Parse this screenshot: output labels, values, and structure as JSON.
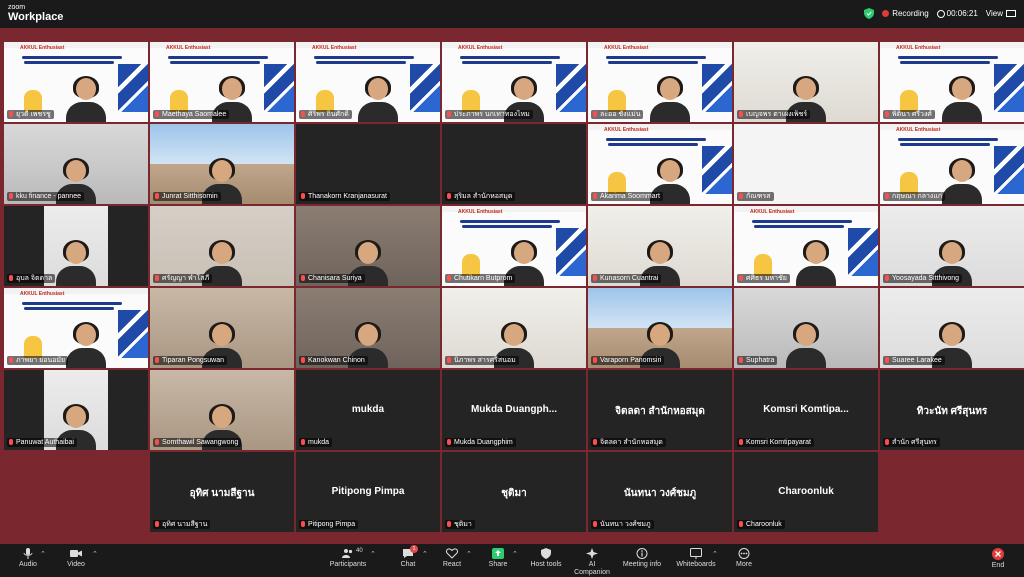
{
  "app": {
    "brand_line1": "zoom",
    "brand_line2": "Workplace"
  },
  "status": {
    "recording_label": "Recording",
    "timer": "00:06:21",
    "view_label": "View"
  },
  "slide": {
    "logo_text": "AKKUL Enthusiast"
  },
  "participants": [
    "ยุวดี เพชรชู",
    "Maethaya Saomalee",
    "ศิริพร ถิ่นศักดิ์",
    "ประภาพร นกเทาทองไหม",
    "ละออ ชั่งแม่น",
    "เบญจพร ตาเผงเพ็ชร์",
    "พิตินา ศรีวงศ์",
    "kku finance - pannee",
    "Junrat Sitthisomin",
    "Thanakorn Kranjanasurat",
    "สุริมล สำนักหอสมุด",
    "Akarima Soommart",
    "กัณฑรส",
    "กฤษณา กลางแก่",
    "อุบล จิตตาล",
    "ศรัญญา พำโสภี",
    "Chanisara Suriya",
    "Chutikarn Butprom",
    "Kunasorn Cuantrai",
    "ศศิธร มหาชัย",
    "Yoosayada Sitthivong",
    "ภาพยา ยอนอมัย",
    "Tiparan Pongsuwan",
    "Kanokwan Chinon",
    "นิภาพร สารศรีสนอม",
    "Varaporn Panomsiri",
    "Suphatra",
    "Suaree Larakee",
    "Panuwat Authaibai",
    "Somthawil Sawangwong",
    "mukda",
    "Mukda Duangphim",
    "จิตลดา สำนักหอสมุด",
    "Komsri Komtipayarat",
    "สำนัก ศรีสุนทร",
    "อุทิศ นามสีฐาน",
    "Pitipong Pimpa",
    "ชุติมา",
    "นันทนา วงศ์ชมภู",
    "Charoonluk"
  ],
  "center_names": {
    "mukda": "mukda",
    "mukda2": "Mukda Duangph...",
    "jitlada": "จิตลดา สำนักหอสมุด",
    "komsri": "Komsri Komtipa...",
    "tiwanat": "ทิวะนัท ศรีสุนทร",
    "uthit": "อุทิศ นามสีฐาน",
    "pitipong": "Pitipong Pimpa",
    "chutima": "ชุติมา",
    "nanthana": "นันทนา วงศ์ชมภู",
    "charoonluk": "Charoonluk"
  },
  "toolbar": {
    "audio": "Audio",
    "video": "Video",
    "participants": "Participants",
    "participants_count": "40",
    "chat": "Chat",
    "chat_badge": "1",
    "react": "React",
    "share": "Share",
    "host_tools": "Host tools",
    "ai_companion": "AI Companion",
    "meeting_info": "Meeting info",
    "whiteboards": "Whiteboards",
    "more": "More",
    "end": "End"
  },
  "colors": {
    "stage_bg": "#7a2730",
    "bar_bg": "#1a1a1a",
    "active_border": "#9fe3a8",
    "end_red": "#e23b3b"
  }
}
